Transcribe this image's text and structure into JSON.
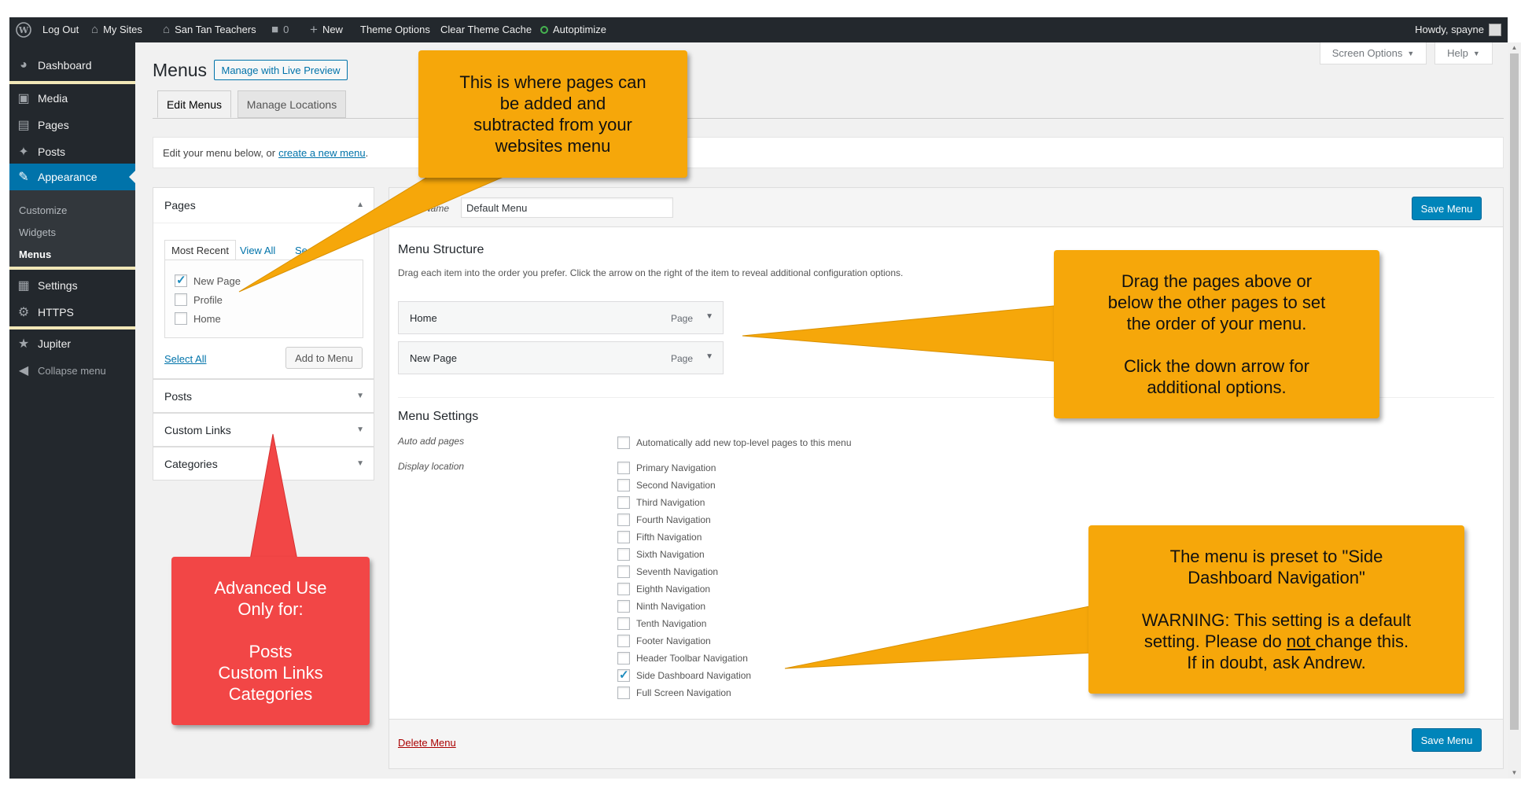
{
  "adminbar": {
    "logout": "Log Out",
    "my_sites": "My Sites",
    "site_name": "San Tan Teachers",
    "comments": "0",
    "new": "New",
    "theme_options": "Theme Options",
    "clear_cache": "Clear Theme Cache",
    "autoptimize": "Autoptimize",
    "howdy": "Howdy, spayne"
  },
  "sidebar": {
    "dashboard": "Dashboard",
    "media": "Media",
    "pages": "Pages",
    "posts": "Posts",
    "appearance": "Appearance",
    "customize": "Customize",
    "widgets": "Widgets",
    "menus": "Menus",
    "settings": "Settings",
    "https": "HTTPS",
    "jupiter": "Jupiter",
    "collapse": "Collapse menu"
  },
  "header": {
    "title": "Menus",
    "live_preview": "Manage with Live Preview",
    "screen_options": "Screen Options",
    "help": "Help",
    "tab_edit": "Edit Menus",
    "tab_locations": "Manage Locations",
    "notice_prefix": "Edit your menu below, or ",
    "notice_link": "create a new menu",
    "notice_suffix": "."
  },
  "left_panel": {
    "pages_title": "Pages",
    "tab_recent": "Most Recent",
    "tab_all": "View All",
    "tab_search": "Se",
    "items": [
      {
        "label": "New Page",
        "checked": true
      },
      {
        "label": "Profile",
        "checked": false
      },
      {
        "label": "Home",
        "checked": false
      }
    ],
    "select_all": "Select All",
    "add_to_menu": "Add to Menu",
    "posts_title": "Posts",
    "custom_links_title": "Custom Links",
    "categories_title": "Categories"
  },
  "menu_panel": {
    "menu_name_label": "Name",
    "menu_name_value": "Default Menu",
    "save_menu": "Save Menu",
    "structure_title": "Menu Structure",
    "structure_desc": "Drag each item into the order you prefer. Click the arrow on the right of the item to reveal additional configuration options.",
    "items": [
      {
        "title": "Home",
        "type": "Page"
      },
      {
        "title": "New Page",
        "type": "Page"
      }
    ],
    "settings_title": "Menu Settings",
    "auto_add_label": "Auto add pages",
    "auto_add_option": "Automatically add new top-level pages to this menu",
    "display_location_label": "Display location",
    "locations": [
      {
        "label": "Primary Navigation",
        "checked": false
      },
      {
        "label": "Second Navigation",
        "checked": false
      },
      {
        "label": "Third Navigation",
        "checked": false
      },
      {
        "label": "Fourth Navigation",
        "checked": false
      },
      {
        "label": "Fifth Navigation",
        "checked": false
      },
      {
        "label": "Sixth Navigation",
        "checked": false
      },
      {
        "label": "Seventh Navigation",
        "checked": false
      },
      {
        "label": "Eighth Navigation",
        "checked": false
      },
      {
        "label": "Ninth Navigation",
        "checked": false
      },
      {
        "label": "Tenth Navigation",
        "checked": false
      },
      {
        "label": "Footer Navigation",
        "checked": false
      },
      {
        "label": "Header Toolbar Navigation",
        "checked": false
      },
      {
        "label": "Side Dashboard Navigation",
        "checked": true
      },
      {
        "label": "Full Screen Navigation",
        "checked": false
      }
    ],
    "delete_menu": "Delete Menu"
  },
  "callouts": {
    "top": {
      "lines": [
        "This is where pages can",
        "be added and",
        "subtracted from your",
        "websites menu"
      ]
    },
    "drag": {
      "l1": "Drag the pages above or",
      "l2": "below the other pages to set",
      "l3": "the order of your menu.",
      "l4": "Click the down arrow for",
      "l5": "additional options."
    },
    "warning": {
      "l1": "The menu is preset to \"Side",
      "l2": "Dashboard Navigation\"",
      "l3": "WARNING: This setting is a default",
      "l4a": "setting. Please do ",
      "l4b": "not ",
      "l4c": "change this.",
      "l5": "If in doubt, ask Andrew."
    },
    "advanced": {
      "l1": "Advanced Use",
      "l2": "Only for:",
      "l3": "Posts",
      "l4": "Custom Links",
      "l5": "Categories"
    }
  },
  "colors": {
    "admin_dark": "#23282d",
    "wp_blue": "#0073aa",
    "callout_orange": "#f6a70a",
    "callout_red": "#f24646"
  }
}
